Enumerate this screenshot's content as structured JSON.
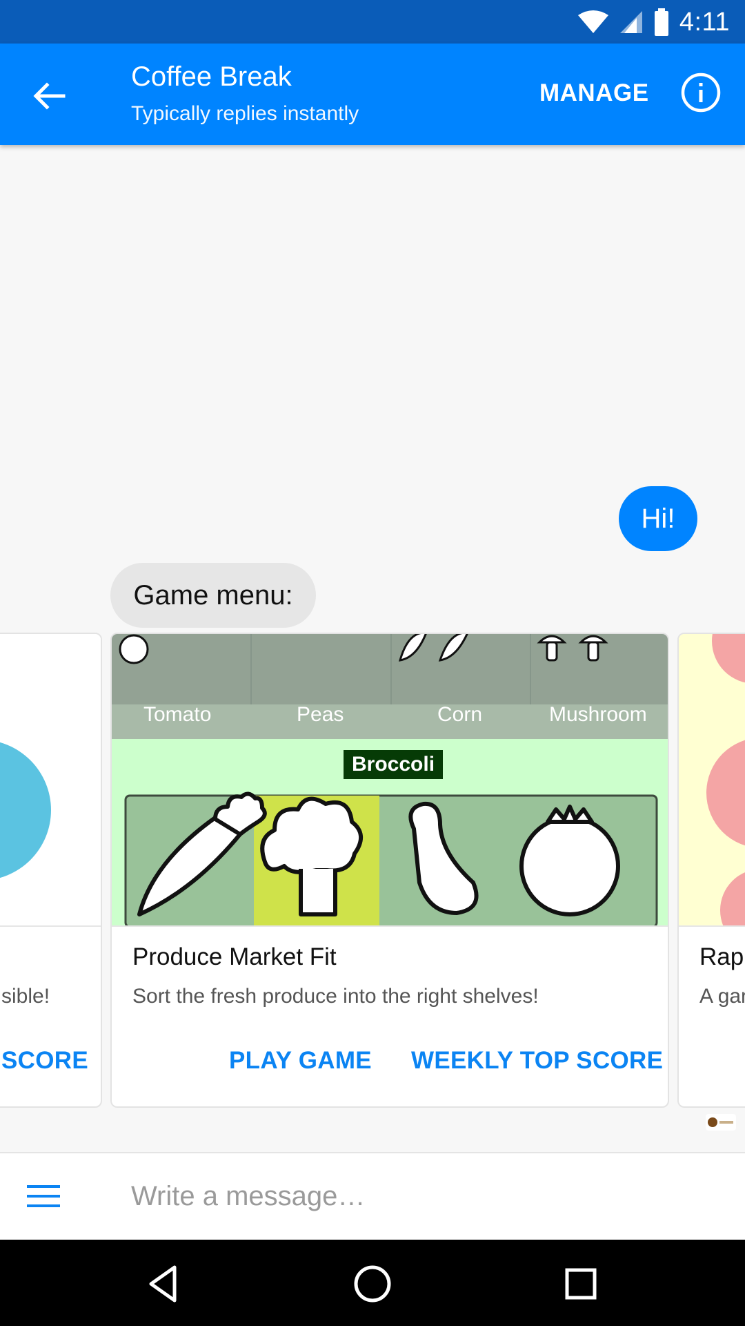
{
  "status_bar": {
    "time": "4:11"
  },
  "header": {
    "title": "Coffee Break",
    "subtitle": "Typically replies instantly",
    "manage_label": "MANAGE"
  },
  "messages": {
    "outgoing": "Hi!",
    "incoming": "Game menu:"
  },
  "carousel": {
    "left_card": {
      "subtitle_fragment": "sible!",
      "button_fragment": "SCORE"
    },
    "main_card": {
      "shelf_labels": [
        "Tomato",
        "Peas",
        "Corn",
        "Mushroom"
      ],
      "target_label": "Broccoli",
      "title": "Produce Market Fit",
      "subtitle": "Sort the fresh produce into the right shelves!",
      "play_button": "PLAY GAME",
      "score_button": "WEEKLY TOP SCORE"
    },
    "right_card": {
      "title_fragment": "Rap",
      "subtitle_fragment": "A gar"
    }
  },
  "composer": {
    "placeholder": "Write a message…"
  },
  "colors": {
    "app_bar": "#0084ff",
    "status_bar": "#0a5cb8",
    "accent_button": "#0b84f3",
    "incoming_bubble": "#e6e6e6",
    "highlight": "#cfe24a"
  }
}
